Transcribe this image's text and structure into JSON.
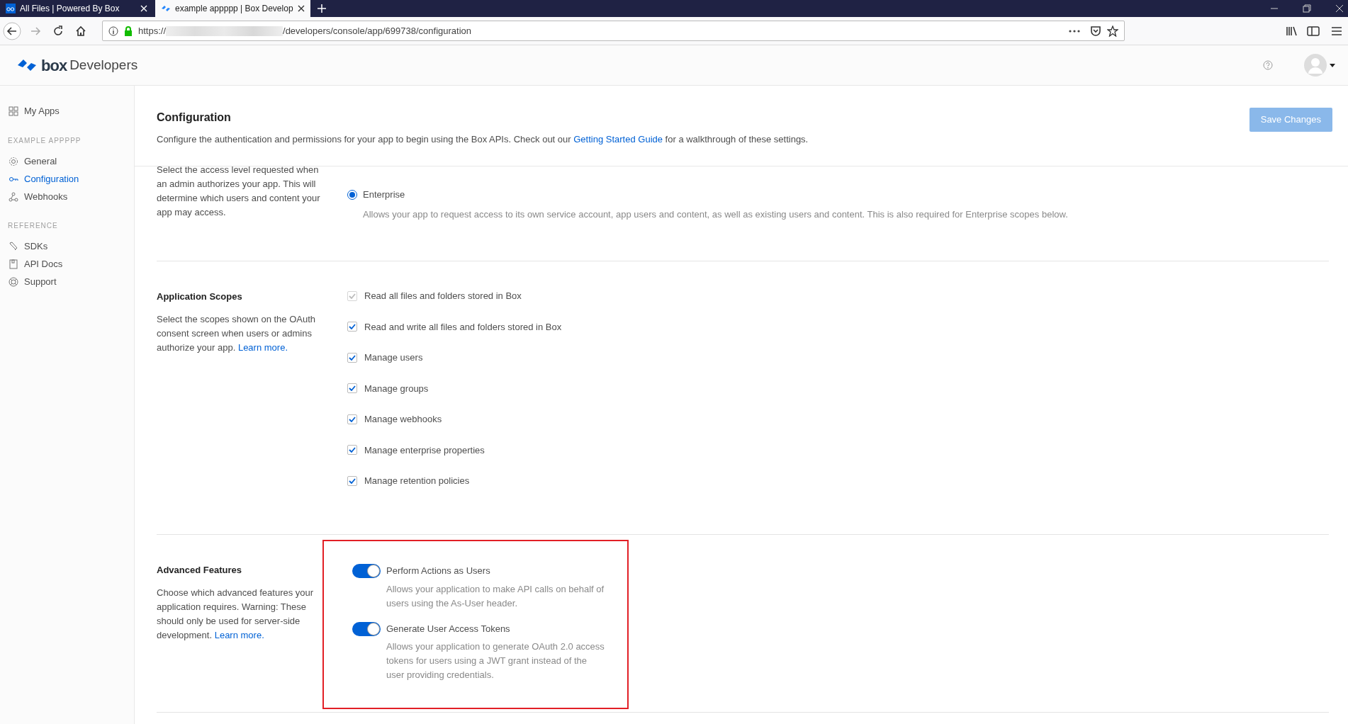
{
  "browser": {
    "tabs": [
      {
        "title": "All Files | Powered By Box",
        "selected": false
      },
      {
        "title": "example appppp | Box Develop",
        "selected": true
      }
    ],
    "url_scheme": "https://",
    "url_path": "/developers/console/app/699738/configuration"
  },
  "header": {
    "brand": "box",
    "product": "Developers"
  },
  "sidebar": {
    "top": {
      "label": "My Apps",
      "selected": false
    },
    "groups": [
      {
        "heading": "EXAMPLE APPPPP",
        "items": [
          {
            "label": "General",
            "selected": false
          },
          {
            "label": "Configuration",
            "selected": true
          },
          {
            "label": "Webhooks",
            "selected": false
          }
        ]
      },
      {
        "heading": "REFERENCE",
        "items": [
          {
            "label": "SDKs",
            "selected": false
          },
          {
            "label": "API Docs",
            "selected": false
          },
          {
            "label": "Support",
            "selected": false
          }
        ]
      }
    ]
  },
  "page": {
    "title": "Configuration",
    "intro": {
      "before": "Configure the authentication and permissions for your app to begin using the Box APIs. Check out our ",
      "link": "Getting Started Guide",
      "after": " for a walkthrough of these settings."
    },
    "save_button": {
      "label": "Save Changes",
      "disabled": true
    }
  },
  "access": {
    "description": "Select the access level requested when an admin authorizes your app. This will determine which users and content your app may access.",
    "options": [
      {
        "label": "Enterprise",
        "selected": true,
        "description": "Allows your app to request access to its own service account, app users and content, as well as existing users and content. This is also required for Enterprise scopes below."
      }
    ]
  },
  "scopes": {
    "title": "Application Scopes",
    "description": "Select the scopes shown on the OAuth consent screen when users or admins authorize your app. ",
    "link": "Learn more.",
    "items": [
      {
        "label": "Read all files and folders stored in Box",
        "checked": true,
        "disabled": true
      },
      {
        "label": "Read and write all files and folders stored in Box",
        "checked": true,
        "disabled": false
      },
      {
        "label": "Manage users",
        "checked": true,
        "disabled": false
      },
      {
        "label": "Manage groups",
        "checked": true,
        "disabled": false
      },
      {
        "label": "Manage webhooks",
        "checked": true,
        "disabled": false
      },
      {
        "label": "Manage enterprise properties",
        "checked": true,
        "disabled": false
      },
      {
        "label": "Manage retention policies",
        "checked": true,
        "disabled": false
      }
    ]
  },
  "advanced": {
    "title": "Advanced Features",
    "description": "Choose which advanced features your application requires. Warning: These should only be used for server-side development. ",
    "link": "Learn more.",
    "features": [
      {
        "label": "Perform Actions as Users",
        "on": true,
        "description": "Allows your application to make API calls on behalf of users using the As-User header."
      },
      {
        "label": "Generate User Access Tokens",
        "on": true,
        "description": "Allows your application to generate OAuth 2.0 access tokens for users using a JWT grant instead of the user providing credentials."
      }
    ]
  }
}
